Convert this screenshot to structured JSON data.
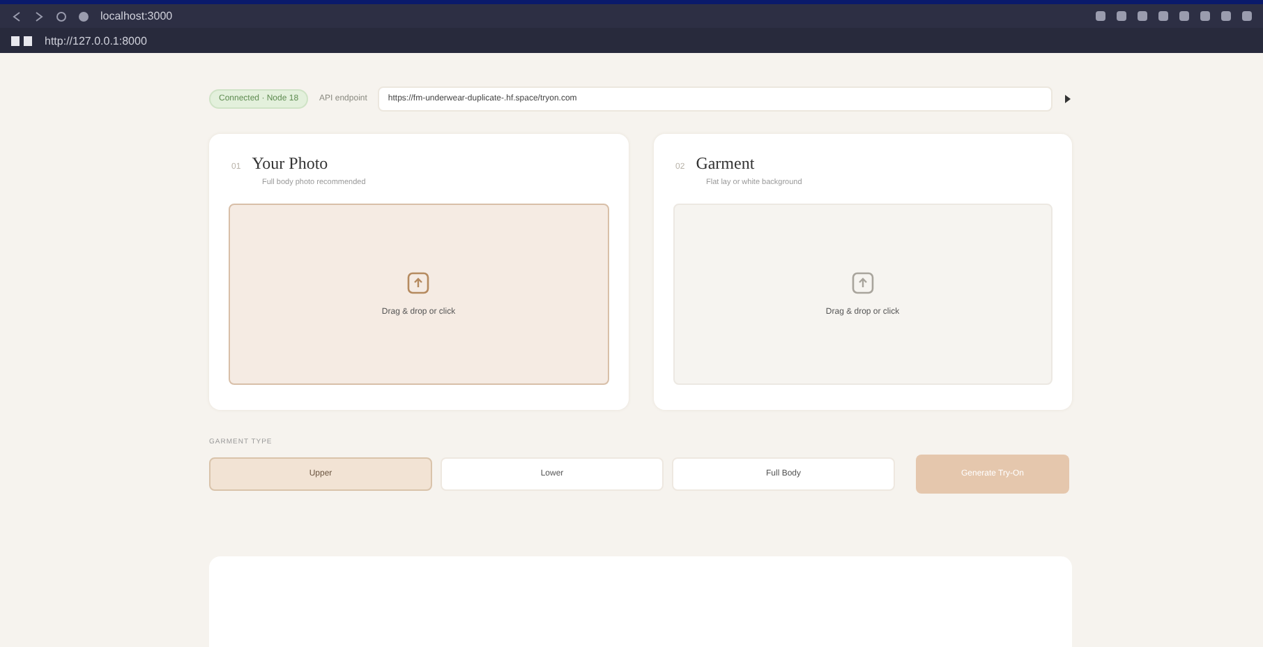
{
  "browser": {
    "address": "localhost:3000",
    "bookmark": "http://127.0.0.1:8000"
  },
  "connection": {
    "status": "Connected · Node 18",
    "label": "API endpoint",
    "url": "https://fm-underwear-duplicate-.hf.space/tryon.com"
  },
  "cards": [
    {
      "number": "01",
      "title": "Your Photo",
      "subtitle": "Full body photo recommended",
      "upload": "Drag & drop or click",
      "active": true
    },
    {
      "number": "02",
      "title": "Garment",
      "subtitle": "Flat lay or white background",
      "upload": "Drag & drop or click",
      "active": false
    }
  ],
  "garment_type": {
    "label": "GARMENT TYPE",
    "options": [
      {
        "label": "Upper",
        "selected": true
      },
      {
        "label": "Lower",
        "selected": false
      },
      {
        "label": "Full Body",
        "selected": false
      }
    ]
  },
  "generate_button": {
    "label": "Generate Try-On",
    "disabled": true
  }
}
